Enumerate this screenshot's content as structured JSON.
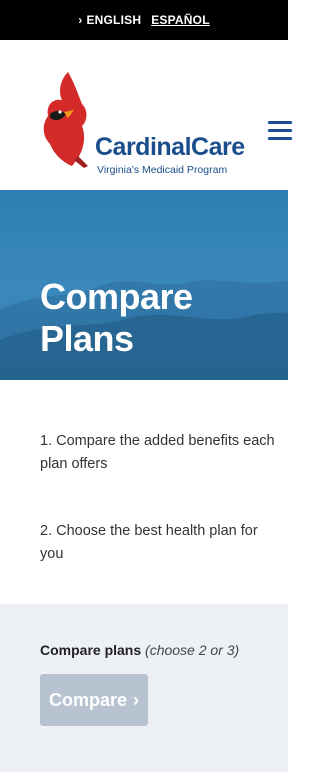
{
  "language_bar": {
    "active": "ENGLISH",
    "alternate": "ESPAÑOL"
  },
  "header": {
    "logo_name": "CardinalCare",
    "logo_tagline": "Virginia's Medicaid Program",
    "menu_icon": "hamburger-menu-icon"
  },
  "hero": {
    "title": "Compare Plans"
  },
  "steps": [
    "1. Compare the added benefits each plan offers",
    "2. Choose the best health plan for you"
  ],
  "compare": {
    "label": "Compare plans",
    "hint": "(choose 2 or 3)",
    "button_label": "Compare",
    "button_icon": "chevron-right-icon",
    "button_enabled": false
  },
  "colors": {
    "brand_blue": "#1b4e8c",
    "cardinal_red": "#d42a2a",
    "hero_blue": "#3b88bc",
    "panel_bg": "#edf1f5",
    "disabled_button": "#b7c3d1"
  }
}
